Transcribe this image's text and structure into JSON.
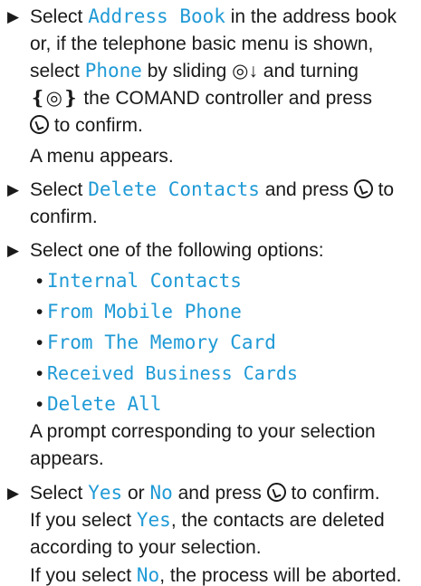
{
  "step1": {
    "line1_pre": "Select ",
    "line1_ui": "Address Book",
    "line1_post": " in the address book",
    "line2": "or, if the telephone basic menu is shown,",
    "line3_pre": "select ",
    "line3_ui": "Phone",
    "line3_post": " by sliding ◎↓ and turning",
    "line4": "❴◎❵ the COMAND controller and press",
    "line5": " to confirm.",
    "result": "A menu appears."
  },
  "step2": {
    "line1_pre": "Select ",
    "line1_ui": "Delete Contacts",
    "line1_post": " and press ",
    "line1_end": " to",
    "line2": "confirm."
  },
  "step3": {
    "line1": "Select one of the following options:",
    "options": [
      "Internal Contacts",
      "From Mobile Phone",
      "From The Memory Card",
      "Received Business Cards",
      "Delete All"
    ],
    "result1": "A prompt corresponding to your selection",
    "result2": "appears."
  },
  "step4": {
    "line1_pre": "Select ",
    "yes": "Yes",
    "or": " or ",
    "no": "No",
    "line1_post": " and press ",
    "line1_end": " to confirm.",
    "if_yes_pre": "If you select ",
    "if_yes_post": ", the contacts are deleted",
    "if_yes_line2": "according to your selection.",
    "if_no_pre": "If you select ",
    "if_no_post": ", the process will be aborted."
  }
}
